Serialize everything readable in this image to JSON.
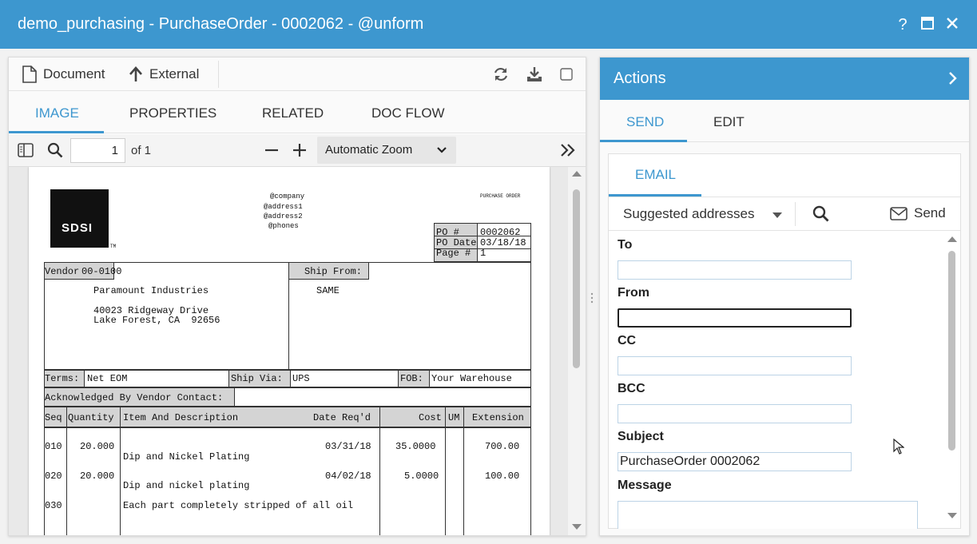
{
  "window": {
    "title": "demo_purchasing - PurchaseOrder - 0002062 - @unform",
    "help_glyph": "?",
    "colors": {
      "header": "#3d97cf",
      "accent": "#3d97cf"
    }
  },
  "toolbar": {
    "document_label": "Document",
    "external_label": "External"
  },
  "tabs": [
    "IMAGE",
    "PROPERTIES",
    "RELATED",
    "DOC FLOW"
  ],
  "viewer": {
    "page_number": "1",
    "page_count_text": "of 1",
    "zoom_label": "Automatic Zoom"
  },
  "po": {
    "logo_text": "SDSI",
    "logo_tm": "TM",
    "company_lines": [
      "@company",
      "@address1",
      "@address2",
      "@phones"
    ],
    "doc_type": "PURCHASE ORDER",
    "po_number_label": "PO #",
    "po_number": "0002062",
    "po_date_label": "PO Date",
    "po_date": "03/18/18",
    "page_label": "Page #",
    "page": "1",
    "vendor_label": "Vendor",
    "vendor_id": "00-0100",
    "vendor_name": "Paramount Industries",
    "vendor_addr1": "40023 Ridgeway Drive",
    "vendor_addr2": "Lake Forest, CA  92656",
    "ship_from_label": "Ship From:",
    "ship_from_value": "SAME",
    "terms_label": "Terms:",
    "terms_value": "Net EOM",
    "ship_via_label": "Ship Via:",
    "ship_via_value": "UPS",
    "fob_label": "FOB:",
    "fob_value": "Your Warehouse",
    "ack_label": "Acknowledged By Vendor Contact:",
    "columns": [
      "Seq",
      "Quantity",
      "Item And Description",
      "Date Req'd",
      "Cost",
      "UM",
      "Extension"
    ],
    "lines": [
      {
        "seq": "010",
        "qty": "20.000",
        "desc": "Dip and Nickel Plating",
        "date": "03/31/18",
        "cost": "35.0000",
        "um": "",
        "ext": "700.00"
      },
      {
        "seq": "020",
        "qty": "20.000",
        "desc": "Dip and nickel plating",
        "date": "04/02/18",
        "cost": "5.0000",
        "um": "",
        "ext": "100.00"
      },
      {
        "seq": "030",
        "qty": "",
        "desc": "Each part completely stripped of all oil",
        "date": "",
        "cost": "",
        "um": "",
        "ext": ""
      }
    ]
  },
  "actions": {
    "title": "Actions",
    "tabs": [
      "SEND",
      "EDIT"
    ],
    "email_tab": "EMAIL",
    "suggested_label": "Suggested addresses",
    "send_label": "Send",
    "fields": {
      "to_label": "To",
      "to_value": "",
      "from_label": "From",
      "from_value": "",
      "cc_label": "CC",
      "cc_value": "",
      "bcc_label": "BCC",
      "bcc_value": "",
      "subject_label": "Subject",
      "subject_value": "PurchaseOrder 0002062",
      "message_label": "Message",
      "message_value": ""
    }
  }
}
